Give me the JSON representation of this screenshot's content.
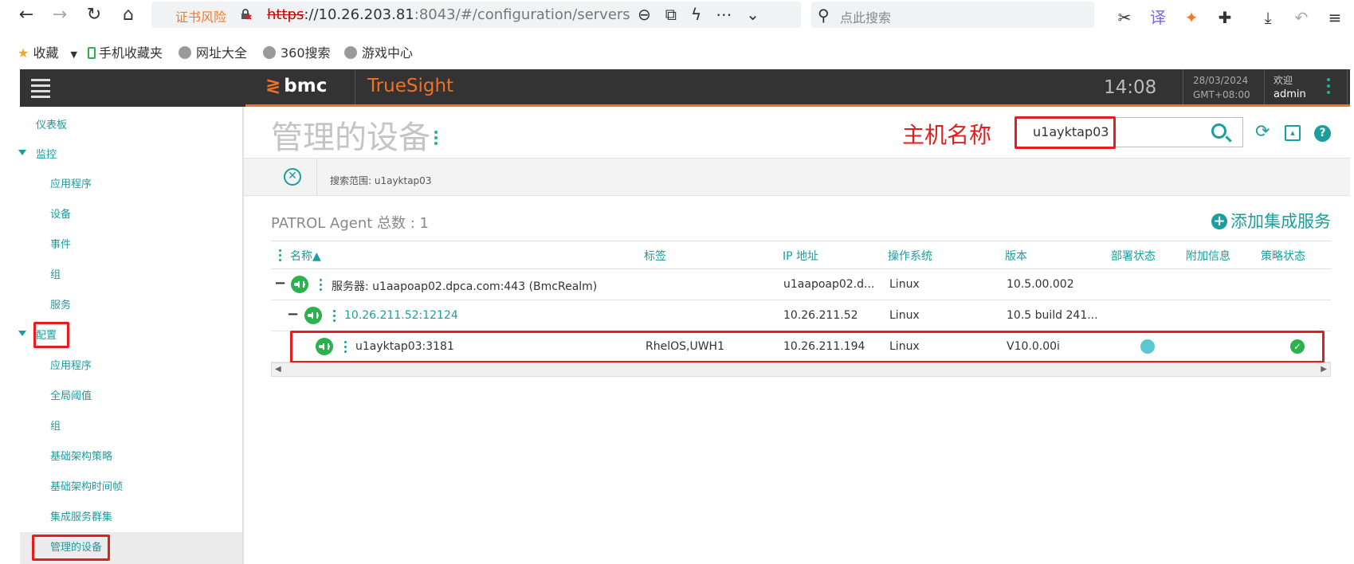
{
  "browser": {
    "security_warning": "证书风险",
    "url_protocol": "https",
    "url_host": "://10.26.203.81",
    "url_rest": ":8043/#/configuration/servers",
    "search_placeholder": "点此搜索"
  },
  "bookmarks": [
    {
      "label": "收藏"
    },
    {
      "label": "手机收藏夹"
    },
    {
      "label": "网址大全"
    },
    {
      "label": "360搜索"
    },
    {
      "label": "游戏中心"
    }
  ],
  "app_header": {
    "brand": "bmc",
    "product": "TrueSight",
    "time": "14:08",
    "date": "28/03/2024",
    "timezone": "GMT+08:00",
    "welcome": "欢迎",
    "user": "admin"
  },
  "sidebar": {
    "dashboard": "仪表板",
    "monitor": {
      "label": "监控",
      "items": [
        "应用程序",
        "设备",
        "事件",
        "组",
        "服务"
      ]
    },
    "config": {
      "label": "配置",
      "items": [
        "应用程序",
        "全局阈值",
        "组",
        "基础架构策略",
        "基础架构时间帧",
        "集成服务群集",
        "管理的设备"
      ]
    }
  },
  "main": {
    "title": "管理的设备",
    "annotation_label": "主机名称",
    "search_value": "u1ayktap03",
    "filter_text": "搜索范围: u1ayktap03",
    "agent_count": "PATROL Agent 总数 : 1",
    "add_service": "添加集成服务"
  },
  "table": {
    "headers": {
      "name": "名称▲",
      "tags": "标签",
      "ip": "IP 地址",
      "os": "操作系统",
      "version": "版本",
      "deploy": "部署状态",
      "extra": "附加信息",
      "policy": "策略状态"
    },
    "rows": [
      {
        "name": "服务器: u1aapoap02.dpca.com:443 (BmcRealm)",
        "tags": "",
        "ip": "u1aapoap02.d...",
        "os": "Linux",
        "version": "10.5.00.002"
      },
      {
        "name": "10.26.211.52:12124",
        "tags": "",
        "ip": "10.26.211.52",
        "os": "Linux",
        "version": "10.5 build 241..."
      },
      {
        "name": "u1ayktap03:3181",
        "tags": "RhelOS,UWH1",
        "ip": "10.26.211.194",
        "os": "Linux",
        "version": "V10.0.00i"
      }
    ]
  },
  "colors": {
    "accent": "#1a9e9e",
    "brand_orange": "#f36f21",
    "annotation_red": "#e51d1d",
    "header_bg": "#333333"
  }
}
